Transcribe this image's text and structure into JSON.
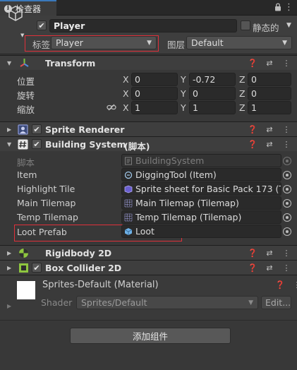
{
  "tab": {
    "title": "检查器"
  },
  "object": {
    "name": "Player",
    "active": true,
    "static_label": "静态的",
    "tag_label": "标签",
    "tag_value": "Player",
    "layer_label": "图层",
    "layer_value": "Default"
  },
  "transform": {
    "title": "Transform",
    "position": {
      "label": "位置",
      "x": "0",
      "y": "-0.72",
      "z": "0"
    },
    "rotation": {
      "label": "旋转",
      "x": "0",
      "y": "0",
      "z": "0"
    },
    "scale": {
      "label": "缩放",
      "x": "1",
      "y": "1",
      "z": "1"
    },
    "axes": {
      "x": "X",
      "y": "Y",
      "z": "Z"
    }
  },
  "sprite_renderer": {
    "title": "Sprite Renderer",
    "enabled": true
  },
  "building_system": {
    "title": "Building System",
    "suffix": "(脚本)",
    "enabled": true,
    "fields": [
      {
        "label": "脚本",
        "value": "BuildingSystem",
        "disabled": true
      },
      {
        "label": "Item",
        "value": "DiggingTool (Item)"
      },
      {
        "label": "Highlight Tile",
        "value": "Sprite sheet for Basic Pack 173 (Tile"
      },
      {
        "label": "Main Tilemap",
        "value": "Main Tilemap (Tilemap)"
      },
      {
        "label": "Temp Tilemap",
        "value": "Temp Tilemap (Tilemap)"
      },
      {
        "label": "Loot Prefab",
        "value": "Loot"
      }
    ]
  },
  "rigidbody": {
    "title": "Rigidbody 2D"
  },
  "box_collider": {
    "title": "Box Collider 2D",
    "enabled": true
  },
  "material": {
    "title": "Sprites-Default (Material)",
    "shader_label": "Shader",
    "shader_value": "Sprites/Default",
    "edit_label": "Edit..."
  },
  "add_component_label": "添加组件",
  "colors": {
    "background": "#383838",
    "header": "#3e3e3e",
    "field": "#2a2a2a",
    "highlight_box": "#e0303a",
    "tab_accent": "#3a79bb"
  }
}
